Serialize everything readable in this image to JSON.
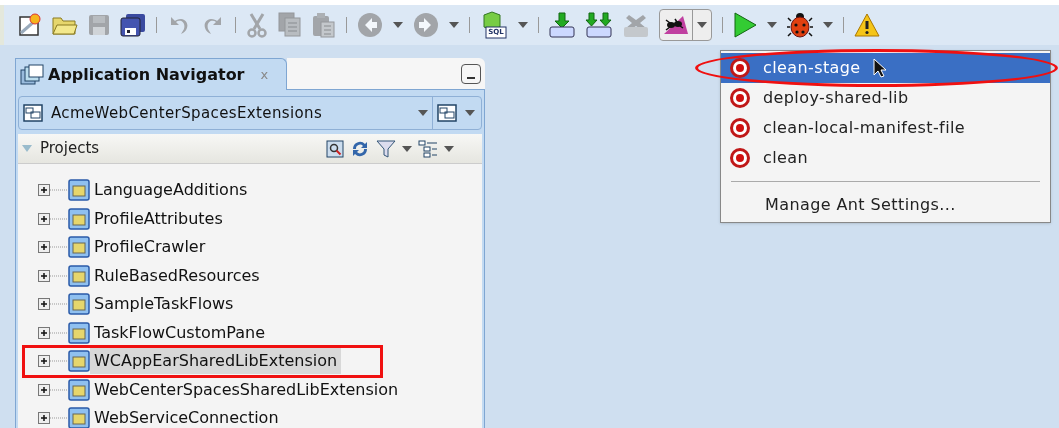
{
  "toolbar": [
    {
      "kind": "new",
      "disabled": false
    },
    {
      "kind": "open",
      "disabled": false
    },
    {
      "kind": "save",
      "disabled": true
    },
    {
      "kind": "save_all",
      "disabled": false
    },
    {
      "kind": "sep"
    },
    {
      "kind": "undo",
      "disabled": true
    },
    {
      "kind": "redo",
      "disabled": true
    },
    {
      "kind": "sep"
    },
    {
      "kind": "cut",
      "disabled": true
    },
    {
      "kind": "copy",
      "disabled": true
    },
    {
      "kind": "paste",
      "disabled": true
    },
    {
      "kind": "sep"
    },
    {
      "kind": "back",
      "disabled": true
    },
    {
      "kind": "caret"
    },
    {
      "kind": "forward",
      "disabled": true
    },
    {
      "kind": "caret"
    },
    {
      "kind": "sep"
    },
    {
      "kind": "sql",
      "disabled": false,
      "label": "SQL"
    },
    {
      "kind": "caret"
    },
    {
      "kind": "sep"
    },
    {
      "kind": "deploy",
      "disabled": false
    },
    {
      "kind": "deploy_all",
      "disabled": false
    },
    {
      "kind": "undeploy",
      "disabled": true
    },
    {
      "kind": "ant",
      "disabled": false,
      "pressed": true
    },
    {
      "kind": "sep"
    },
    {
      "kind": "run",
      "disabled": false
    },
    {
      "kind": "caret"
    },
    {
      "kind": "debug",
      "disabled": false
    },
    {
      "kind": "caret"
    },
    {
      "kind": "sep"
    },
    {
      "kind": "warning",
      "disabled": false
    }
  ],
  "navigator": {
    "title": "Application Navigator",
    "close": "x",
    "application": "AcmeWebCenterSpacesExtensions",
    "section": {
      "label": "Projects",
      "expanded": true
    },
    "projects": [
      {
        "label": "LanguageAdditions",
        "expanded": false,
        "selected": false,
        "annotated": false
      },
      {
        "label": "ProfileAttributes",
        "expanded": false,
        "selected": false,
        "annotated": false
      },
      {
        "label": "ProfileCrawler",
        "expanded": false,
        "selected": false,
        "annotated": false
      },
      {
        "label": "RuleBasedResources",
        "expanded": false,
        "selected": false,
        "annotated": false
      },
      {
        "label": "SampleTaskFlows",
        "expanded": false,
        "selected": false,
        "annotated": false
      },
      {
        "label": "TaskFlowCustomPane",
        "expanded": false,
        "selected": false,
        "annotated": false
      },
      {
        "label": "WCAppEarSharedLibExtension",
        "expanded": false,
        "selected": true,
        "annotated": true
      },
      {
        "label": "WebCenterSpacesSharedLibExtension",
        "expanded": false,
        "selected": false,
        "annotated": false
      },
      {
        "label": "WebServiceConnection",
        "expanded": false,
        "selected": false,
        "annotated": false
      }
    ]
  },
  "ant_menu": {
    "targets": [
      {
        "label": "clean-stage",
        "selected": true,
        "annotated": true
      },
      {
        "label": "deploy-shared-lib",
        "selected": false,
        "annotated": false
      },
      {
        "label": "clean-local-manifest-file",
        "selected": false,
        "annotated": false
      },
      {
        "label": "clean",
        "selected": false,
        "annotated": false
      }
    ],
    "settings": "Manage Ant Settings..."
  }
}
